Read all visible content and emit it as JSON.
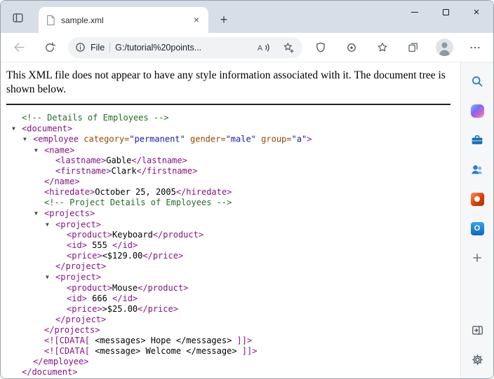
{
  "window": {
    "tab": {
      "title": "sample.xml",
      "close_glyph": "×"
    },
    "new_tab_glyph": "+",
    "controls": {
      "close_glyph": "×"
    }
  },
  "toolbar": {
    "address": {
      "scheme": "File",
      "url": "G:/tutorial%20points..."
    },
    "icons": {
      "read_aloud_letter": "A"
    }
  },
  "notice": "This XML file does not appear to have any style information associated with it. The document tree is shown below.",
  "sidebar": {
    "outlook_letter": "O",
    "icon_names": [
      "search",
      "copilot",
      "briefcase",
      "people",
      "office",
      "outlook",
      "add",
      "open-sidebar",
      "settings"
    ]
  },
  "icons": {
    "collapse": "▼"
  },
  "xml": {
    "colors": {
      "comment": "#236e25",
      "tag": "#881280",
      "attr_name": "#994500",
      "attr_value": "#1a1aa6",
      "text": "#000000"
    },
    "lines": [
      {
        "i": 0,
        "a": false,
        "p": [
          {
            "t": "comment",
            "v": "<!-- Details of Employees -->"
          }
        ]
      },
      {
        "i": 0,
        "a": true,
        "p": [
          {
            "t": "tag",
            "v": "<document>"
          }
        ]
      },
      {
        "i": 1,
        "a": true,
        "p": [
          {
            "t": "tag",
            "v": "<employee"
          },
          {
            "t": "attr",
            "v": " category="
          },
          {
            "t": "val",
            "v": "\"permanent\""
          },
          {
            "t": "attr",
            "v": " gender="
          },
          {
            "t": "val",
            "v": "\"male\""
          },
          {
            "t": "attr",
            "v": " group="
          },
          {
            "t": "val",
            "v": "\"a\""
          },
          {
            "t": "tag",
            "v": ">"
          }
        ]
      },
      {
        "i": 2,
        "a": true,
        "p": [
          {
            "t": "tag",
            "v": "<name>"
          }
        ]
      },
      {
        "i": 3,
        "a": false,
        "p": [
          {
            "t": "tag",
            "v": "<lastname>"
          },
          {
            "t": "text",
            "v": "Gable"
          },
          {
            "t": "tag",
            "v": "</lastname>"
          }
        ]
      },
      {
        "i": 3,
        "a": false,
        "p": [
          {
            "t": "tag",
            "v": "<firstname>"
          },
          {
            "t": "text",
            "v": "Clark"
          },
          {
            "t": "tag",
            "v": "</firstname>"
          }
        ]
      },
      {
        "i": 2,
        "a": false,
        "p": [
          {
            "t": "tag",
            "v": "</name>"
          }
        ]
      },
      {
        "i": 2,
        "a": false,
        "p": [
          {
            "t": "tag",
            "v": "<hiredate>"
          },
          {
            "t": "text",
            "v": "October 25, 2005"
          },
          {
            "t": "tag",
            "v": "</hiredate>"
          }
        ]
      },
      {
        "i": 2,
        "a": false,
        "p": [
          {
            "t": "comment",
            "v": "<!-- Project Details of Employees -->"
          }
        ]
      },
      {
        "i": 2,
        "a": true,
        "p": [
          {
            "t": "tag",
            "v": "<projects>"
          }
        ]
      },
      {
        "i": 3,
        "a": true,
        "p": [
          {
            "t": "tag",
            "v": "<project>"
          }
        ]
      },
      {
        "i": 4,
        "a": false,
        "p": [
          {
            "t": "tag",
            "v": "<product>"
          },
          {
            "t": "text",
            "v": "Keyboard"
          },
          {
            "t": "tag",
            "v": "</product>"
          }
        ]
      },
      {
        "i": 4,
        "a": false,
        "p": [
          {
            "t": "tag",
            "v": "<id>"
          },
          {
            "t": "text",
            "v": " 555 "
          },
          {
            "t": "tag",
            "v": "</id>"
          }
        ]
      },
      {
        "i": 4,
        "a": false,
        "p": [
          {
            "t": "tag",
            "v": "<price>"
          },
          {
            "t": "text",
            "v": "<$129.00"
          },
          {
            "t": "tag",
            "v": "</price>"
          }
        ]
      },
      {
        "i": 3,
        "a": false,
        "p": [
          {
            "t": "tag",
            "v": "</project>"
          }
        ]
      },
      {
        "i": 3,
        "a": true,
        "p": [
          {
            "t": "tag",
            "v": "<project>"
          }
        ]
      },
      {
        "i": 4,
        "a": false,
        "p": [
          {
            "t": "tag",
            "v": "<product>"
          },
          {
            "t": "text",
            "v": "Mouse"
          },
          {
            "t": "tag",
            "v": "</product>"
          }
        ]
      },
      {
        "i": 4,
        "a": false,
        "p": [
          {
            "t": "tag",
            "v": "<id>"
          },
          {
            "t": "text",
            "v": " 666 "
          },
          {
            "t": "tag",
            "v": "</id>"
          }
        ]
      },
      {
        "i": 4,
        "a": false,
        "p": [
          {
            "t": "tag",
            "v": "<price>"
          },
          {
            "t": "text",
            "v": ">$25.00"
          },
          {
            "t": "tag",
            "v": "</price>"
          }
        ]
      },
      {
        "i": 3,
        "a": false,
        "p": [
          {
            "t": "tag",
            "v": "</project>"
          }
        ]
      },
      {
        "i": 2,
        "a": false,
        "p": [
          {
            "t": "tag",
            "v": "</projects>"
          }
        ]
      },
      {
        "i": 2,
        "a": false,
        "p": [
          {
            "t": "tag",
            "v": "<![CDATA["
          },
          {
            "t": "text",
            "v": " <messages> Hope </messages> "
          },
          {
            "t": "tag",
            "v": "]]>"
          }
        ]
      },
      {
        "i": 2,
        "a": false,
        "p": [
          {
            "t": "tag",
            "v": "<![CDATA["
          },
          {
            "t": "text",
            "v": " <message> Welcome </message> "
          },
          {
            "t": "tag",
            "v": "]]>"
          }
        ]
      },
      {
        "i": 1,
        "a": false,
        "p": [
          {
            "t": "tag",
            "v": "</employee>"
          }
        ]
      },
      {
        "i": 0,
        "a": false,
        "p": [
          {
            "t": "tag",
            "v": "</document>"
          }
        ]
      }
    ]
  }
}
